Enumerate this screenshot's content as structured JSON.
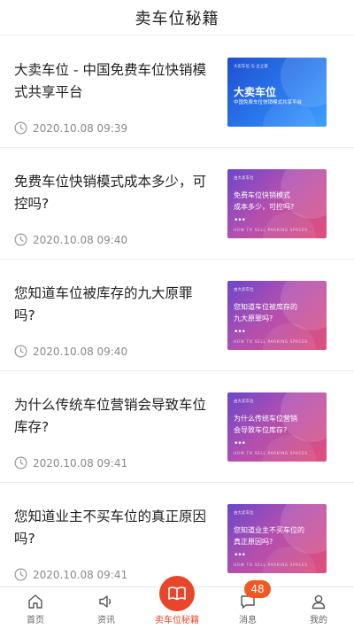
{
  "header": {
    "title": "卖车位秘籍"
  },
  "articles": [
    {
      "title": "大卖车位 - 中国免费车位快销模式共享平台",
      "date": "2020.10.08 09:39",
      "thumb": {
        "style": "blue",
        "brand": "大卖车位 与 企之家",
        "big": "大卖车位",
        "sub": "中国免费车位快销模式共享平台",
        "foot": ""
      }
    },
    {
      "title": "免费车位快销模式成本多少，可控吗?",
      "date": "2020.10.08 09:40",
      "thumb": {
        "style": "pink",
        "brand": "由大卖车位",
        "line1": "免费车位快销模式",
        "line2": "成本多少，可控吗?",
        "foot": "HOW TO SELL PARKING SPACES"
      }
    },
    {
      "title": "您知道车位被库存的九大原罪吗?",
      "date": "2020.10.08 09:40",
      "thumb": {
        "style": "pink",
        "brand": "由大卖车位",
        "line1": "您知道车位被库存的",
        "line2": "九大原罪吗?",
        "foot": "HOW TO SELL PARKING SPACES"
      }
    },
    {
      "title": "为什么传统车位营销会导致车位库存?",
      "date": "2020.10.08 09:41",
      "thumb": {
        "style": "pink",
        "brand": "由大卖车位",
        "line1": "为什么传统车位营销",
        "line2": "会导致车位库存?",
        "foot": "HOW TO SELL PARKING SPACES"
      }
    },
    {
      "title": "您知道业主不买车位的真正原因吗?",
      "date": "2020.10.08 09:41",
      "thumb": {
        "style": "pink",
        "brand": "由大卖车位",
        "line1": "您知道业主不买车位的",
        "line2": "真正原因吗?",
        "foot": "HOW TO SELL PARKING SPACES"
      }
    }
  ],
  "tabbar": {
    "tabs": [
      {
        "label": "首页",
        "icon": "home-icon"
      },
      {
        "label": "资讯",
        "icon": "speaker-icon"
      },
      {
        "label": "卖车位秘籍",
        "icon": "book-icon"
      },
      {
        "label": "消息",
        "icon": "message-icon",
        "badge": "48"
      },
      {
        "label": "我的",
        "icon": "user-icon"
      }
    ]
  },
  "colors": {
    "accent": "#e8462a",
    "badge": "#f05a22"
  }
}
